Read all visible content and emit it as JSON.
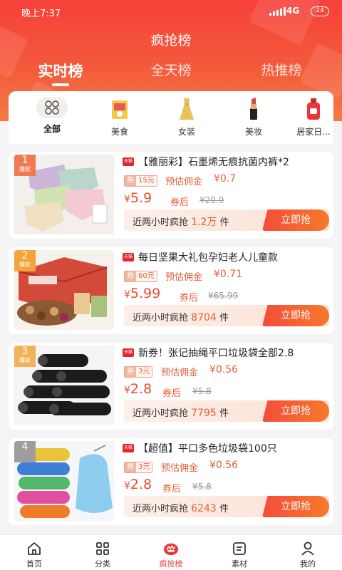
{
  "status": {
    "time": "晚上7:37",
    "network": "4G",
    "battery": "24"
  },
  "page_title": "疯抢榜",
  "tabs": [
    {
      "label": "实时榜"
    },
    {
      "label": "全天榜"
    },
    {
      "label": "热推榜"
    }
  ],
  "categories": [
    {
      "label": "全部",
      "icon": "grid-icon"
    },
    {
      "label": "美食",
      "icon": "snack-box-icon"
    },
    {
      "label": "女装",
      "icon": "dress-icon"
    },
    {
      "label": "美妆",
      "icon": "lipstick-icon"
    },
    {
      "label": "居家日...",
      "icon": "detergent-bottle-icon"
    }
  ],
  "products": [
    {
      "rank": "1",
      "hot": "爆款",
      "tmall": "天猫",
      "title": "【雅丽彩】石墨烯无痕抗菌内裤*2",
      "coupon_label": "券",
      "coupon": "15元",
      "commission_label": "预估佣金",
      "commission": "¥0.7",
      "currency": "¥",
      "price": "5.9",
      "after_label": "券后",
      "original": "¥20.9",
      "sales_prefix": "近两小时疯抢",
      "sales_count": "1.2万",
      "sales_unit": "件",
      "buy_label": "立即抢",
      "rank_color": "#f07a52"
    },
    {
      "rank": "2",
      "hot": "爆款",
      "tmall": "天猫",
      "title": "每日坚果大礼包孕妇老人儿童款",
      "coupon_label": "券",
      "coupon": "60元",
      "commission_label": "预估佣金",
      "commission": "¥0.71",
      "currency": "¥",
      "price": "5.99",
      "after_label": "券后",
      "original": "¥65.99",
      "sales_prefix": "近两小时疯抢",
      "sales_count": "8704",
      "sales_unit": "件",
      "buy_label": "立即抢",
      "rank_color": "#f5a33a"
    },
    {
      "rank": "3",
      "hot": "爆款",
      "tmall": "天猫",
      "title": "新券！张记抽绳平口垃圾袋全部2.8",
      "coupon_label": "券",
      "coupon": "3元",
      "commission_label": "预估佣金",
      "commission": "¥0.56",
      "currency": "¥",
      "price": "2.8",
      "after_label": "券后",
      "original": "¥5.8",
      "sales_prefix": "近两小时疯抢",
      "sales_count": "7795",
      "sales_unit": "件",
      "buy_label": "立即抢",
      "rank_color": "#f2b25a"
    },
    {
      "rank": "4",
      "hot": "",
      "tmall": "天猫",
      "title": "【超值】平口多色垃圾袋100只",
      "coupon_label": "券",
      "coupon": "3元",
      "commission_label": "预估佣金",
      "commission": "¥0.56",
      "currency": "¥",
      "price": "2.8",
      "after_label": "券后",
      "original": "¥5.8",
      "sales_prefix": "近两小时疯抢",
      "sales_count": "6243",
      "sales_unit": "件",
      "buy_label": "立即抢",
      "rank_color": "#9e9e9e"
    }
  ],
  "nav": [
    {
      "label": "首页",
      "icon": "home-icon"
    },
    {
      "label": "分类",
      "icon": "category-grid-icon"
    },
    {
      "label": "疯抢榜",
      "icon": "hot-rank-icon"
    },
    {
      "label": "素材",
      "icon": "material-icon"
    },
    {
      "label": "我的",
      "icon": "profile-icon"
    }
  ],
  "colors": {
    "accent": "#f6403a",
    "price": "#ee4a2f",
    "active_nav": "#e8363a"
  }
}
